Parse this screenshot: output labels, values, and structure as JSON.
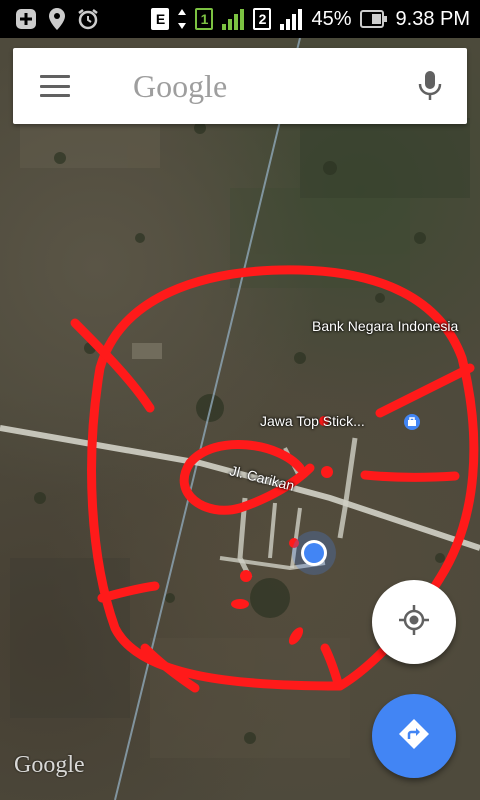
{
  "status_bar": {
    "battery_percent": "45%",
    "time": "9.38 PM",
    "network_type": "E",
    "sim1_label": "1",
    "sim2_label": "2",
    "icons": [
      "add-box-icon",
      "location-pin-icon",
      "alarm-icon",
      "data-arrows-icon",
      "signal-icon",
      "battery-icon"
    ]
  },
  "search": {
    "logo_text": "Google",
    "menu_icon": "hamburger-menu-icon",
    "mic_icon": "microphone-icon"
  },
  "map": {
    "labels": {
      "bank": "Bank Negara Indonesia",
      "shop": "Jawa Top Stick...",
      "road": "Jl. Carikan"
    },
    "watermark": "Google",
    "colors": {
      "annotation": "#ff1a1a",
      "road": "#d9d9cf",
      "location_dot": "#4285f4"
    }
  },
  "fabs": {
    "my_location_icon": "my-location-icon",
    "directions_icon": "directions-icon",
    "directions_color": "#4285f4"
  }
}
